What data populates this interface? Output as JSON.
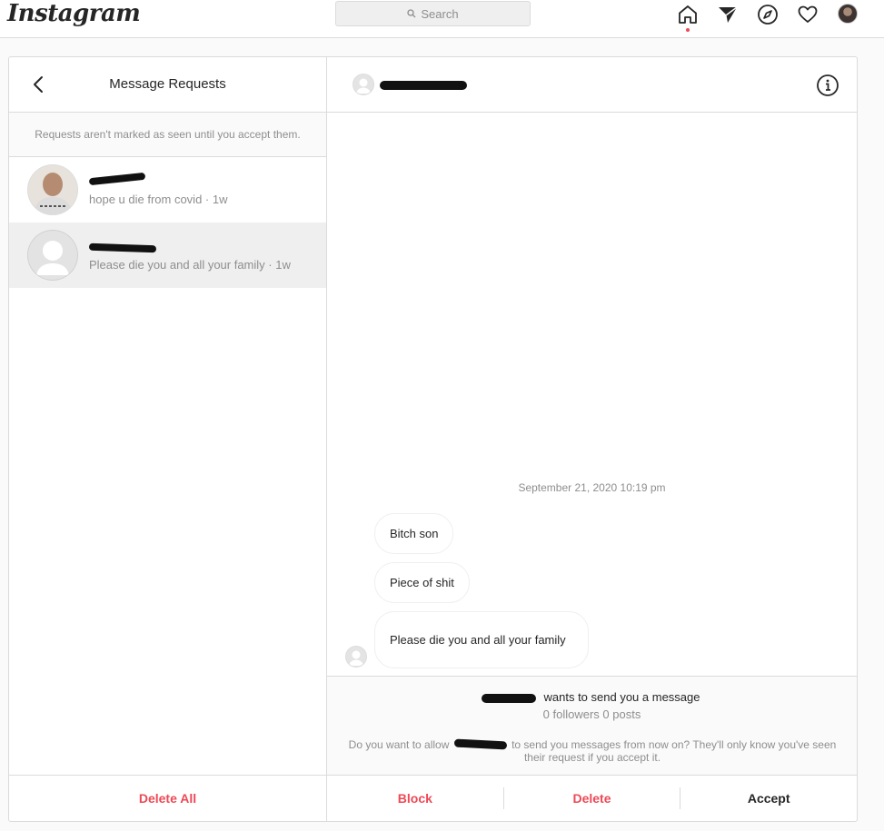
{
  "app": {
    "logo": "Instagram"
  },
  "search": {
    "label": "Search"
  },
  "nav": {
    "icons": [
      "home-icon",
      "direct-icon",
      "explore-icon",
      "heart-icon",
      "profile-avatar"
    ]
  },
  "left": {
    "title": "Message Requests",
    "notice": "Requests aren't marked as seen until you accept them.",
    "requests": [
      {
        "preview": "hope u die from covid · 1w",
        "active": false
      },
      {
        "preview": "Please die you and all your family · 1w",
        "active": true
      }
    ],
    "delete_all": "Delete All"
  },
  "chat": {
    "timestamp": "September 21, 2020 10:19 pm",
    "messages": [
      "Bitch son",
      "Piece of shit",
      "Please die you and all your family"
    ],
    "wants": "wants to send you a message",
    "stats": "0 followers 0 posts",
    "allow_before": "Do you want to allow",
    "allow_after": "to send you messages from now on? They'll only know you've seen their request if you accept it.",
    "actions": {
      "block": "Block",
      "delete": "Delete",
      "accept": "Accept"
    }
  },
  "colors": {
    "danger": "#ed4956",
    "border": "#dbdbdb",
    "muted": "#8e8e8e"
  }
}
